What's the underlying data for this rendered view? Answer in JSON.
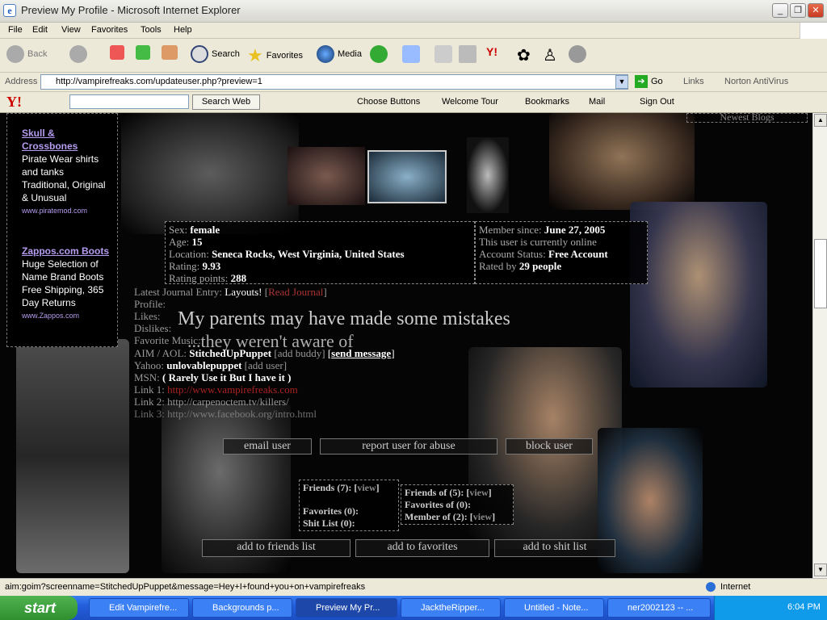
{
  "window": {
    "title": "Preview My Profile - Microsoft Internet Explorer"
  },
  "menu": [
    "File",
    "Edit",
    "View",
    "Favorites",
    "Tools",
    "Help"
  ],
  "toolbar": {
    "back": "Back",
    "search": "Search",
    "favorites": "Favorites",
    "media": "Media"
  },
  "address": {
    "label": "Address",
    "url": "http://vampirefreaks.com/updateuser.php?preview=1",
    "go": "Go",
    "links": "Links",
    "norton": "Norton AntiVirus"
  },
  "yahoo": {
    "logo": "Y!",
    "search_btn": "Search Web",
    "choose": "Choose Buttons",
    "tour": "Welcome Tour",
    "bookmarks": "Bookmarks",
    "mail": "Mail",
    "signout": "Sign Out"
  },
  "ads": [
    {
      "title": "Skull & Crossbones",
      "lines": "Pirate Wear shirts and tanks Traditional, Original & Unusual",
      "url": "www.piratemod.com"
    },
    {
      "title": "Zappos.com Boots",
      "lines": "Huge Selection of Name Brand Boots Free Shipping, 365 Day Returns",
      "url": "www.Zappos.com"
    }
  ],
  "newest_blogs": "Newest Blogs",
  "profile": {
    "sex_label": "Sex:",
    "sex": "female",
    "age_label": "Age:",
    "age": "15",
    "location_label": "Location:",
    "location": "Seneca Rocks, West Virginia, United States",
    "rating_label": "Rating:",
    "rating": "9.93",
    "points_label": "Rating points:",
    "points": "288"
  },
  "member": {
    "since_label": "Member since:",
    "since": "June 27, 2005",
    "online": "This user is currently online",
    "status_label": "Account Status:",
    "status": "Free Account",
    "rated_label": "Rated by",
    "rated": "29 people"
  },
  "journal": {
    "label": "Latest Journal Entry:",
    "title": "Layouts!",
    "read": "Read Journal"
  },
  "fields": {
    "profile": "Profile:",
    "likes": "Likes:",
    "dislikes": "Dislikes:",
    "music": "Favorite Music:"
  },
  "quote": "My parents may have made some mistakes",
  "quote2": "...they weren't aware of",
  "contacts": {
    "aim_label": "AIM / AOL:",
    "aim": "StitchedUpPuppet",
    "add_buddy": "add buddy",
    "send": "send message",
    "yahoo_label": "Yahoo:",
    "yahoo": "unlovablepuppet",
    "add_user": "add user",
    "msn_label": "MSN:",
    "msn": "( Rarely Use it But I have it )",
    "link1_label": "Link 1:",
    "link1": "http://www.vampirefreaks.com",
    "link2_label": "Link 2:",
    "link2": "http://carpenoctem.tv/killers/",
    "link3_label": "Link 3:",
    "link3": "http://www.facebook.org/intro.html"
  },
  "actions": {
    "email": "email user",
    "report": "report user for abuse",
    "block": "block user"
  },
  "friends": {
    "friends": "Friends",
    "friends_n": "(7):",
    "view": "view",
    "friends_of": "Friends of",
    "friends_of_n": "(5):",
    "fav": "Favorites",
    "fav_n": "(0):",
    "fav_of": "Favorites of",
    "fav_of_n": "(0):",
    "shit": "Shit List",
    "shit_n": "(0):",
    "member_of": "Member of",
    "member_of_n": "(2):"
  },
  "bottom": {
    "friends": "add to friends list",
    "fav": "add to favorites",
    "shit": "add to shit list"
  },
  "status": {
    "text": "aim:goim?screenname=StitchedUpPuppet&message=Hey+I+found+you+on+vampirefreaks",
    "zone": "Internet"
  },
  "taskbar": {
    "start": "start",
    "tasks": [
      "Edit Vampirefre...",
      "Backgrounds p...",
      "Preview My Pr...",
      "JacktheRipper...",
      "Untitled - Note...",
      "ner2002123 -- ..."
    ],
    "time": "6:04 PM"
  }
}
